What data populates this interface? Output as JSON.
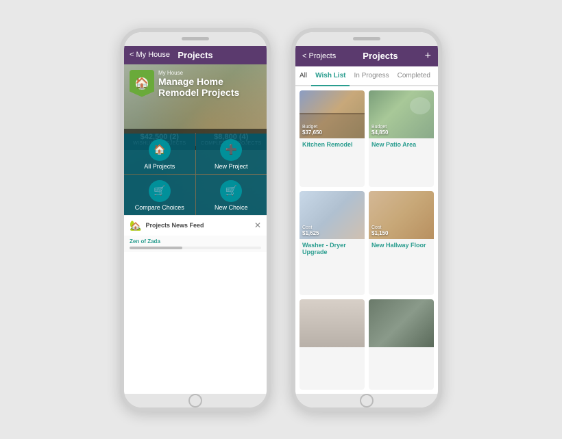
{
  "left_phone": {
    "header": {
      "back_label": "< My House",
      "title": "Projects"
    },
    "hero": {
      "subtitle": "My House",
      "title": "Manage Home\nRemodel Projects"
    },
    "stats": [
      {
        "value": "$42,500 (2)",
        "label": "WISHLIST PROJECTS"
      },
      {
        "value": "$8,800 (4)",
        "label": "COMPLETED PROJECTS"
      }
    ],
    "actions": [
      {
        "icon": "🏠",
        "label": "All Projects"
      },
      {
        "icon": "➕",
        "label": "New Project"
      },
      {
        "icon": "🛒",
        "label": "Compare Choices"
      },
      {
        "icon": "🛒",
        "label": "New Choice"
      }
    ],
    "newsfeed": {
      "label": "Projects News Feed",
      "source": "Zen of Zada"
    }
  },
  "right_phone": {
    "header": {
      "back_label": "< Projects",
      "title": "Projects",
      "plus_label": "+"
    },
    "tabs": [
      {
        "label": "All",
        "active": false
      },
      {
        "label": "Wish List",
        "active": true
      },
      {
        "label": "In Progress",
        "active": false
      },
      {
        "label": "Completed",
        "active": false
      }
    ],
    "projects": [
      {
        "img_class": "img-kitchen",
        "budget_label": "Budget",
        "budget_value": "$37,650",
        "name": "Kitchen Remodel"
      },
      {
        "img_class": "img-patio",
        "budget_label": "Budget",
        "budget_value": "$4,850",
        "name": "New Patio Area"
      },
      {
        "img_class": "img-washer",
        "budget_label": "Cost",
        "budget_value": "$1,625",
        "name": "Washer - Dryer Upgrade"
      },
      {
        "img_class": "img-hallway",
        "budget_label": "Cost",
        "budget_value": "$1,150",
        "name": "New Hallway Floor"
      },
      {
        "img_class": "img-blinds",
        "budget_label": "",
        "budget_value": "",
        "name": ""
      },
      {
        "img_class": "img-trash",
        "budget_label": "",
        "budget_value": "",
        "name": ""
      }
    ]
  }
}
